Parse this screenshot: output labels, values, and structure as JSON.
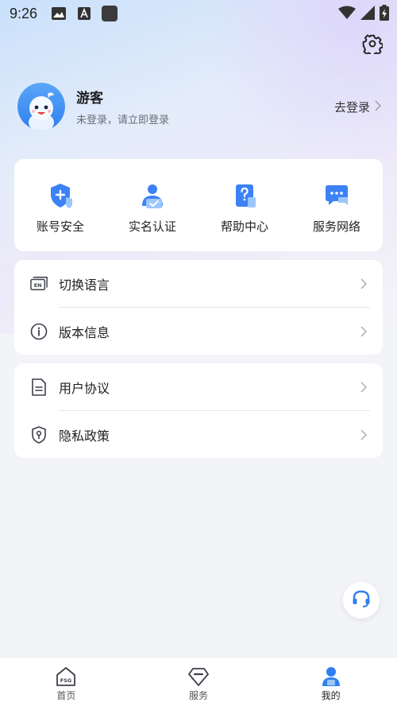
{
  "status_bar": {
    "time": "9:26",
    "icons": [
      "image-icon",
      "font-icon",
      "app-square-icon",
      "wifi-icon",
      "signal-icon",
      "battery-charging-icon"
    ]
  },
  "header": {
    "settings_icon": "gear-icon"
  },
  "profile": {
    "name": "游客",
    "subtitle": "未登录，请立即登录",
    "login_label": "去登录"
  },
  "quick_actions": [
    {
      "label": "账号安全",
      "icon": "shield-plus-icon"
    },
    {
      "label": "实名认证",
      "icon": "user-verify-icon"
    },
    {
      "label": "帮助中心",
      "icon": "question-doc-icon"
    },
    {
      "label": "服务网络",
      "icon": "chat-bubble-icon"
    }
  ],
  "settings_group_1": [
    {
      "label": "切换语言",
      "icon": "language-en-icon"
    },
    {
      "label": "版本信息",
      "icon": "info-circle-icon"
    }
  ],
  "settings_group_2": [
    {
      "label": "用户协议",
      "icon": "document-icon"
    },
    {
      "label": "隐私政策",
      "icon": "shield-key-icon"
    }
  ],
  "floating": {
    "icon": "headset-icon"
  },
  "tabbar": {
    "tabs": [
      {
        "label": "首页",
        "icon": "home-fsg-icon"
      },
      {
        "label": "服务",
        "icon": "service-diamond-icon"
      },
      {
        "label": "我的",
        "icon": "user-tab-icon",
        "active": true
      }
    ]
  },
  "colors": {
    "accent": "#3c82f6",
    "accent_light": "#6fb0fb",
    "background": "#f3f4f8"
  }
}
